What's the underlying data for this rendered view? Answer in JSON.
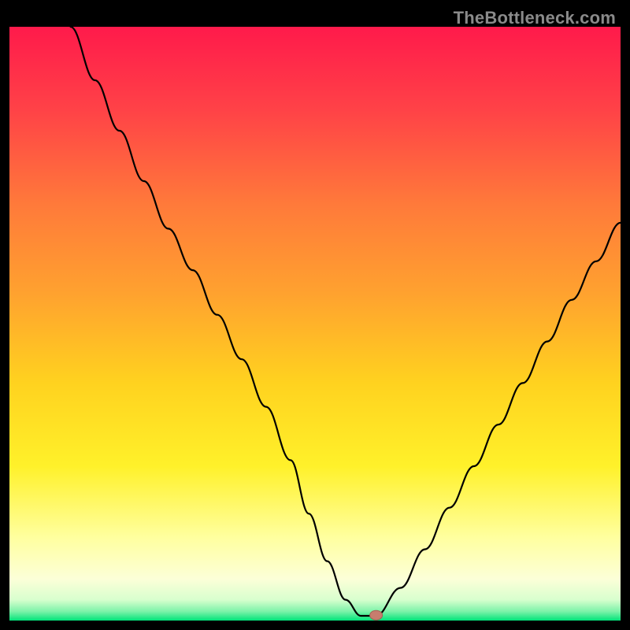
{
  "watermark": "TheBottleneck.com",
  "colors": {
    "frame_bg": "#000000",
    "curve": "#000000",
    "marker_fill": "#c77d6e",
    "marker_stroke": "#a65f52",
    "baseline": "#00e37a",
    "gradient_stops": [
      {
        "offset": 0.0,
        "color": "#ff1a4b"
      },
      {
        "offset": 0.14,
        "color": "#ff4247"
      },
      {
        "offset": 0.3,
        "color": "#ff7a3a"
      },
      {
        "offset": 0.45,
        "color": "#ffa22f"
      },
      {
        "offset": 0.6,
        "color": "#ffd21f"
      },
      {
        "offset": 0.74,
        "color": "#fff12a"
      },
      {
        "offset": 0.86,
        "color": "#ffff9f"
      },
      {
        "offset": 0.93,
        "color": "#fcffd8"
      },
      {
        "offset": 0.965,
        "color": "#d8ffce"
      },
      {
        "offset": 0.985,
        "color": "#7af2a8"
      },
      {
        "offset": 1.0,
        "color": "#00e37a"
      }
    ]
  },
  "chart_data": {
    "type": "line",
    "title": "",
    "xlabel": "",
    "ylabel": "",
    "xlim": [
      0,
      100
    ],
    "ylim": [
      0,
      100
    ],
    "series": [
      {
        "name": "bottleneck-curve",
        "x": [
          10,
          14,
          18,
          22,
          26,
          30,
          34,
          38,
          42,
          46,
          49,
          52,
          55,
          57.5,
          60,
          64,
          68,
          72,
          76,
          80,
          84,
          88,
          92,
          96,
          100
        ],
        "y": [
          100,
          91,
          82.5,
          74,
          66,
          59,
          51.5,
          44,
          36,
          27,
          18,
          10,
          3.5,
          0.8,
          0.8,
          5.5,
          12,
          19,
          26,
          33,
          40,
          47,
          54,
          60.5,
          67
        ]
      }
    ],
    "flat_segment": {
      "x0": 52.5,
      "x1": 60.5,
      "y": 0.8
    },
    "marker": {
      "x": 60,
      "y": 0.9
    },
    "baseline_y": 0
  }
}
